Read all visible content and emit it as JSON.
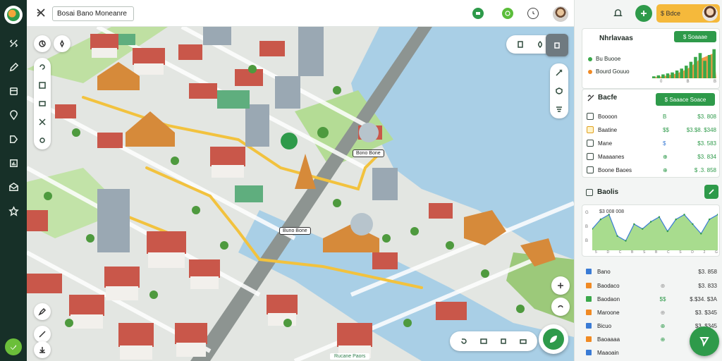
{
  "topbar": {
    "search_value": "Bosai Bano Moneanre"
  },
  "map": {
    "label_a": "Bono Bone",
    "label_b": "Buno Bone",
    "footer_tag": "Rucane Paors"
  },
  "right_panel": {
    "account_label": "$ Bdce",
    "card1": {
      "title": "Nhrlavaas",
      "action": "$ Soaaae",
      "legend": [
        {
          "label": "Bu Buooe",
          "color": "#3aa84a"
        },
        {
          "label": "Bourd Gouuo",
          "color": "#f08a24"
        }
      ],
      "chart_data": {
        "type": "bar",
        "values": [
          2,
          3,
          4,
          5,
          6,
          8,
          10,
          13,
          17,
          22,
          26,
          18,
          24,
          30
        ],
        "area": [
          1,
          1.5,
          2,
          3,
          4,
          5,
          7,
          9,
          12,
          16,
          20,
          22,
          24,
          26
        ],
        "ylim": [
          0,
          32
        ]
      },
      "ticks": [
        "0",
        "B",
        "B"
      ]
    },
    "card2": {
      "title": "Bacfe",
      "action": "$ Saaace Soace",
      "rows": [
        {
          "label": "Boooon",
          "m": "B",
          "v": "$3. 808"
        },
        {
          "label": "Baatine",
          "m": "$$",
          "v": "$3.$8. $348"
        },
        {
          "label": "Mane",
          "m": "$",
          "v": "$3. 583"
        },
        {
          "label": "Maaaanes",
          "m": "⊕",
          "v": "$3. 834"
        },
        {
          "label": "Boone Baoes",
          "m": "⊕",
          "v": "$ .3. 858"
        }
      ]
    },
    "section_title": "Baolis",
    "chart2": {
      "top_label": "$3 008 008",
      "y_ticks": [
        "G",
        "B",
        "B"
      ],
      "x_ticks": [
        "5",
        "D",
        "C",
        "B",
        "S",
        "B",
        "C",
        "S",
        "D",
        "2",
        "G"
      ],
      "chart_data": {
        "type": "area",
        "values": [
          18,
          26,
          30,
          12,
          8,
          22,
          18,
          24,
          28,
          16,
          26,
          30,
          22,
          14,
          26,
          30
        ],
        "ylim": [
          0,
          32
        ]
      }
    },
    "list": [
      {
        "label": "Bano",
        "color": "#3a7bd5",
        "m": "",
        "v": "$3. 858"
      },
      {
        "label": "Baodaco",
        "color": "#f08a24",
        "m": "⊕",
        "v": "$3. 833"
      },
      {
        "label": "Baodaon",
        "color": "#3aa84a",
        "m": "$$",
        "v": "$.$34. $3A"
      },
      {
        "label": "Maroone",
        "color": "#f08a24",
        "m": "⊕",
        "v": "$3.  $345"
      },
      {
        "label": "Bicuo",
        "color": "#3a7bd5",
        "m": "⊕",
        "v": "$3.  $345"
      },
      {
        "label": "Baoaaaa",
        "color": "#f08a24",
        "m": "⊕",
        "v": "$3.  $345"
      },
      {
        "label": "Maaoain",
        "color": "#3a7bd5",
        "m": "",
        "v": ""
      }
    ]
  },
  "colors": {
    "accent": "#2e9a4a",
    "sidebar": "#173028",
    "water": "#a9cfe6",
    "park": "#a8d58a",
    "road": "#f2c23e",
    "account": "#f5b93b"
  }
}
